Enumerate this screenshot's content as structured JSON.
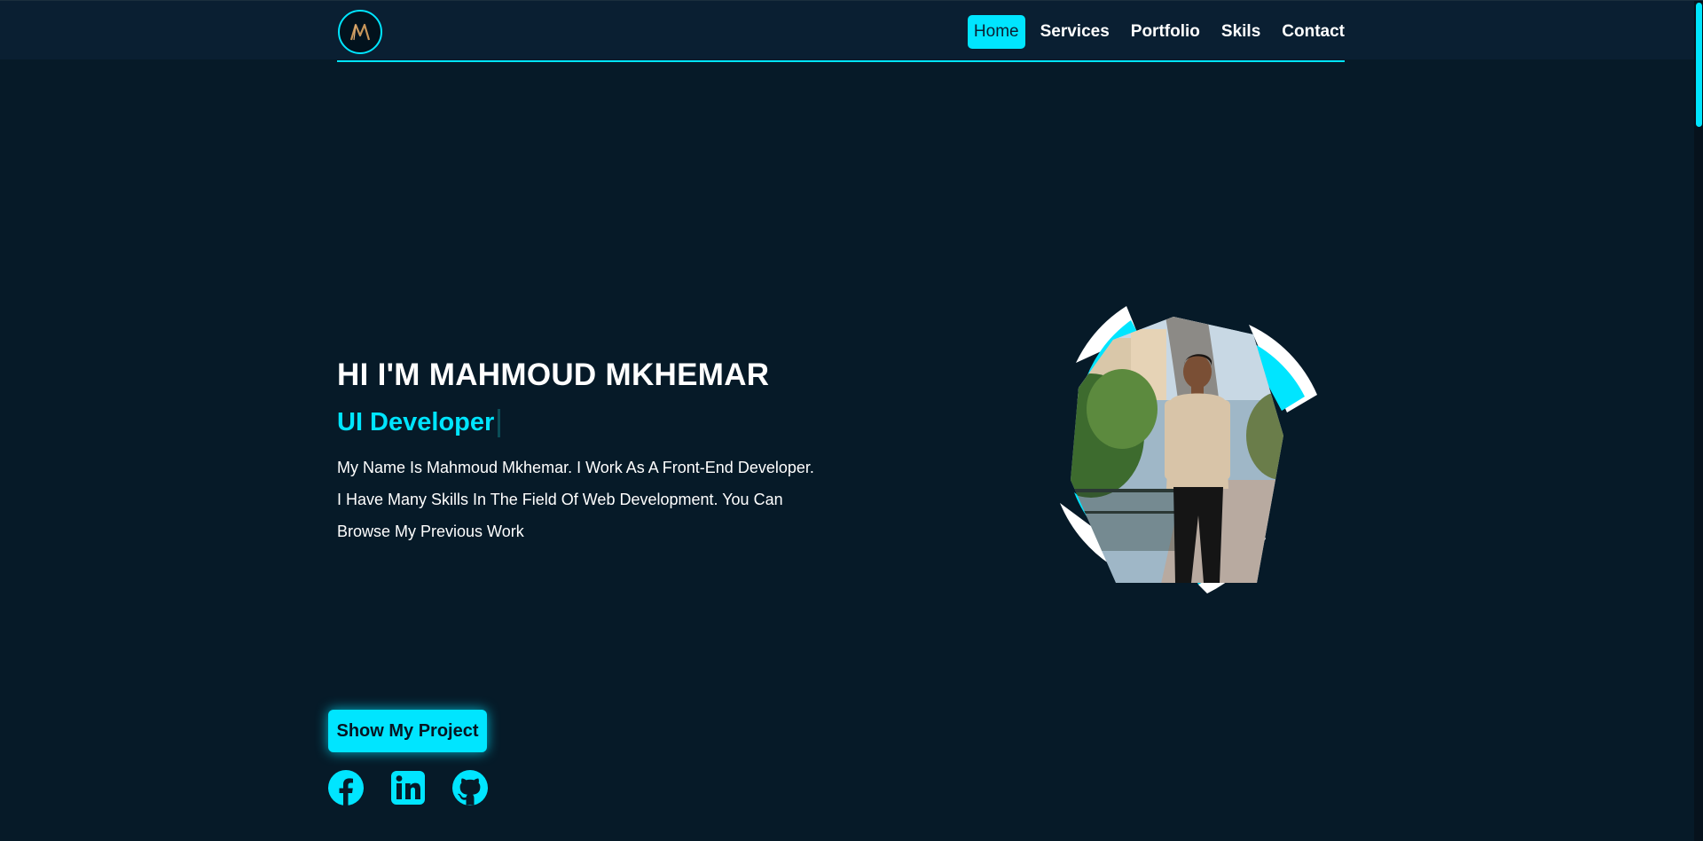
{
  "header": {
    "logo_icon": "m-monogram-logo",
    "nav": [
      {
        "label": "Home",
        "active": true
      },
      {
        "label": "Services",
        "active": false
      },
      {
        "label": "Portfolio",
        "active": false
      },
      {
        "label": "Skils",
        "active": false
      },
      {
        "label": "Contact",
        "active": false
      }
    ]
  },
  "hero": {
    "title": "HI I'M MAHMOUD MKHEMAR",
    "role": "UI Developer",
    "description": "My Name Is Mahmoud Mkhemar. I Work As A Front-End Developer. I Have Many Skills In The Field Of Web Development. You Can Browse My Previous Work",
    "cta_label": "Show My Project",
    "portrait_icon": "profile-photo"
  },
  "social": [
    {
      "icon": "facebook-icon"
    },
    {
      "icon": "linkedin-icon"
    },
    {
      "icon": "github-icon"
    }
  ],
  "colors": {
    "accent": "#00e5ff",
    "background": "#061a28",
    "header_bg": "#0a1f32"
  }
}
